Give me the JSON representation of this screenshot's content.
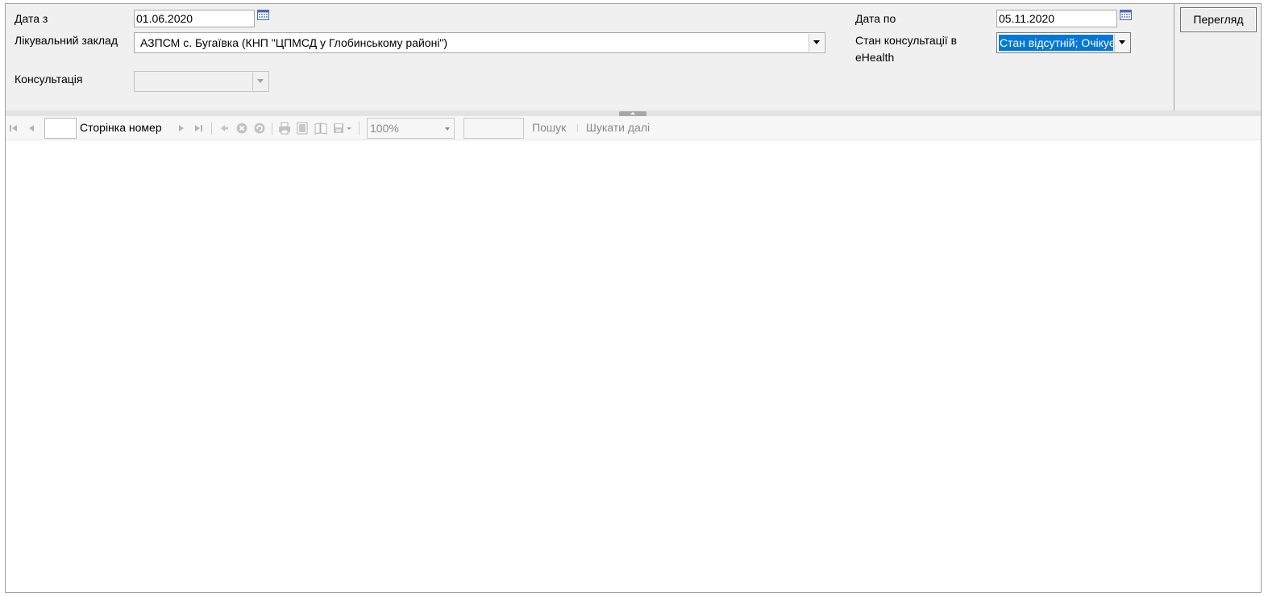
{
  "filters": {
    "date_from_label": "Дата з",
    "date_from_value": "01.06.2020",
    "date_to_label": "Дата по",
    "date_to_value": "05.11.2020",
    "facility_label": "Лікувальний заклад",
    "facility_value": "АЗПСМ с. Бугаївка (КНП \"ЦПМСД у Глобинському районі\")",
    "status_label_line1": "Стан  консультації в",
    "status_label_line2": "eHealth",
    "status_value": "Стан відсутній; Очікує",
    "consultation_label": "Консультація",
    "consultation_value": ""
  },
  "actions": {
    "view_label": "Перегляд"
  },
  "toolbar": {
    "page_number_value": "",
    "page_label": "Сторінка номер",
    "zoom_value": "100%",
    "search_value": "",
    "search_label": "Пошук",
    "find_next_label": "Шукати далі"
  },
  "icons": {
    "calendar": "calendar-icon",
    "first_page": "first-page-icon",
    "prev_page": "previous-page-icon",
    "next_page": "next-page-icon",
    "last_page": "last-page-icon",
    "back": "back-icon",
    "stop": "stop-icon",
    "refresh": "refresh-icon",
    "print": "print-icon",
    "print_layout": "print-layout-icon",
    "page_setup": "page-setup-icon",
    "export": "export-icon"
  },
  "colors": {
    "selection": "#0078d7",
    "panel_bg": "#f0f0f0"
  }
}
